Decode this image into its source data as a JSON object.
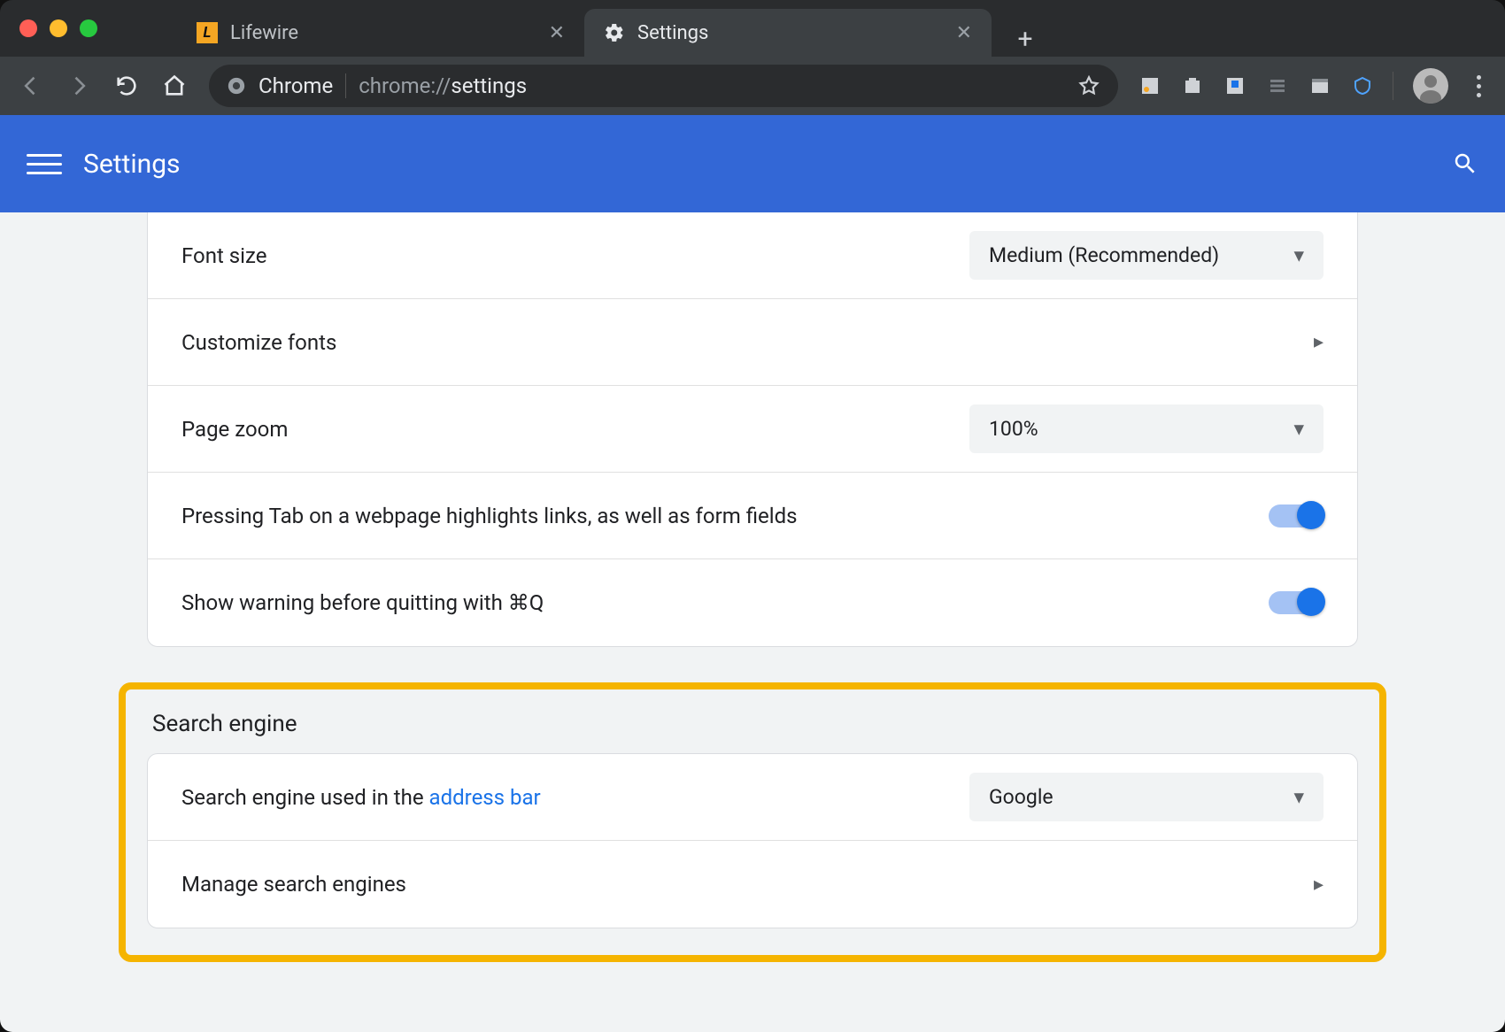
{
  "tabs": [
    {
      "title": "Lifewire"
    },
    {
      "title": "Settings"
    }
  ],
  "omnibox": {
    "origin_label": "Chrome",
    "url_prefix": "chrome://",
    "url_path": "settings"
  },
  "header": {
    "title": "Settings"
  },
  "appearance": {
    "font_size_label": "Font size",
    "font_size_value": "Medium (Recommended)",
    "customize_fonts_label": "Customize fonts",
    "page_zoom_label": "Page zoom",
    "page_zoom_value": "100%",
    "tab_highlight_label": "Pressing Tab on a webpage highlights links, as well as form fields",
    "quit_warning_label": "Show warning before quitting with ⌘Q"
  },
  "search_engine": {
    "section_title": "Search engine",
    "used_in_prefix": "Search engine used in the ",
    "used_in_link": "address bar",
    "value": "Google",
    "manage_label": "Manage search engines"
  }
}
